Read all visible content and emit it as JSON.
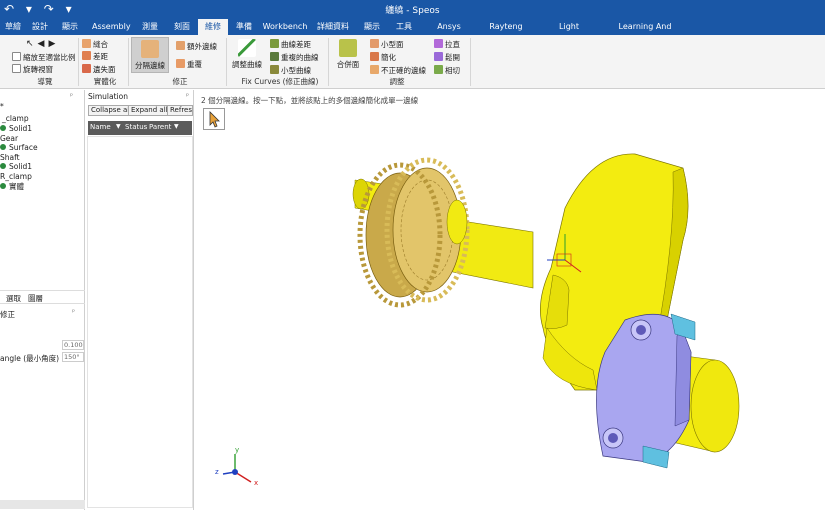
{
  "window": {
    "title": "纏繞 - Speos",
    "quick_access": "↶ ▾ ↷ ▾"
  },
  "tabs": [
    {
      "label": "草繪"
    },
    {
      "label": "設計"
    },
    {
      "label": "顯示"
    },
    {
      "label": "Assembly"
    },
    {
      "label": "測量"
    },
    {
      "label": "刻面"
    },
    {
      "label": "維修"
    },
    {
      "label": "準備"
    },
    {
      "label": "Workbench"
    },
    {
      "label": "詳細資料"
    },
    {
      "label": "顯示"
    },
    {
      "label": "工具"
    },
    {
      "label": "Ansys Motion"
    },
    {
      "label": "Rayteng Tools"
    },
    {
      "label": "Light Simulation"
    },
    {
      "label": "Learning And Support"
    }
  ],
  "active_tab": "維修",
  "ribbon": {
    "nav": {
      "fit_label": "縮放至適當比例",
      "spin_label": "旋轉視窗",
      "group": "導覽"
    },
    "solidify": {
      "stitch": "縫合",
      "gaps": "差距",
      "missing_faces": "遺失面",
      "group": "實體化"
    },
    "split_edges": "分隔邊線",
    "fix": {
      "extra_edges": "額外邊線",
      "duplicates": "重覆",
      "group": "修正"
    },
    "fix_curves": {
      "adjust_curves": "調整曲線",
      "curve_gaps": "曲線差距",
      "duplicate_curves": "重複的曲線",
      "small_curves": "小型曲線",
      "group": "Fix Curves (修正曲線)"
    },
    "adjust": {
      "merge_faces": "合併面",
      "small_faces": "小型面",
      "simplify": "簡化",
      "inexact_edges": "不正確的邊線",
      "straighten": "拉直",
      "relax": "鬆開",
      "tangency": "相切",
      "group": "調整"
    }
  },
  "left_tree": {
    "items": [
      {
        "label": "*"
      },
      {
        "label": "_clamp"
      },
      {
        "label": "Solid1"
      },
      {
        "label": "Gear"
      },
      {
        "label": "Surface"
      },
      {
        "label": "Shaft"
      },
      {
        "label": "Solid1"
      },
      {
        "label": "R_clamp"
      },
      {
        "label": "實體"
      }
    ],
    "tabs": {
      "selection": "選取",
      "layers": "圖層"
    },
    "options_title": "修正",
    "option_value_1": "0.100",
    "option_label_2": "angle (最小角度)",
    "option_value_2": "150°"
  },
  "simulation": {
    "title": "Simulation",
    "collapse": "Collapse all",
    "expand": "Expand all",
    "refresh": "Refresh",
    "columns": [
      "Name",
      "Status",
      "Parent"
    ]
  },
  "viewport": {
    "hint": "2 個分隔邊線。按一下點，並將該點上的多個邊線簡化成單一邊線",
    "axis_labels": {
      "x": "x",
      "y": "y",
      "z": "z"
    }
  },
  "colors": {
    "title_blue": "#1a57a6",
    "part_yellow": "#f3ec10",
    "gear_tan": "#e2c56a",
    "clamp_blue": "#a9a6f0",
    "accent_cyan": "#5fc0e0"
  }
}
